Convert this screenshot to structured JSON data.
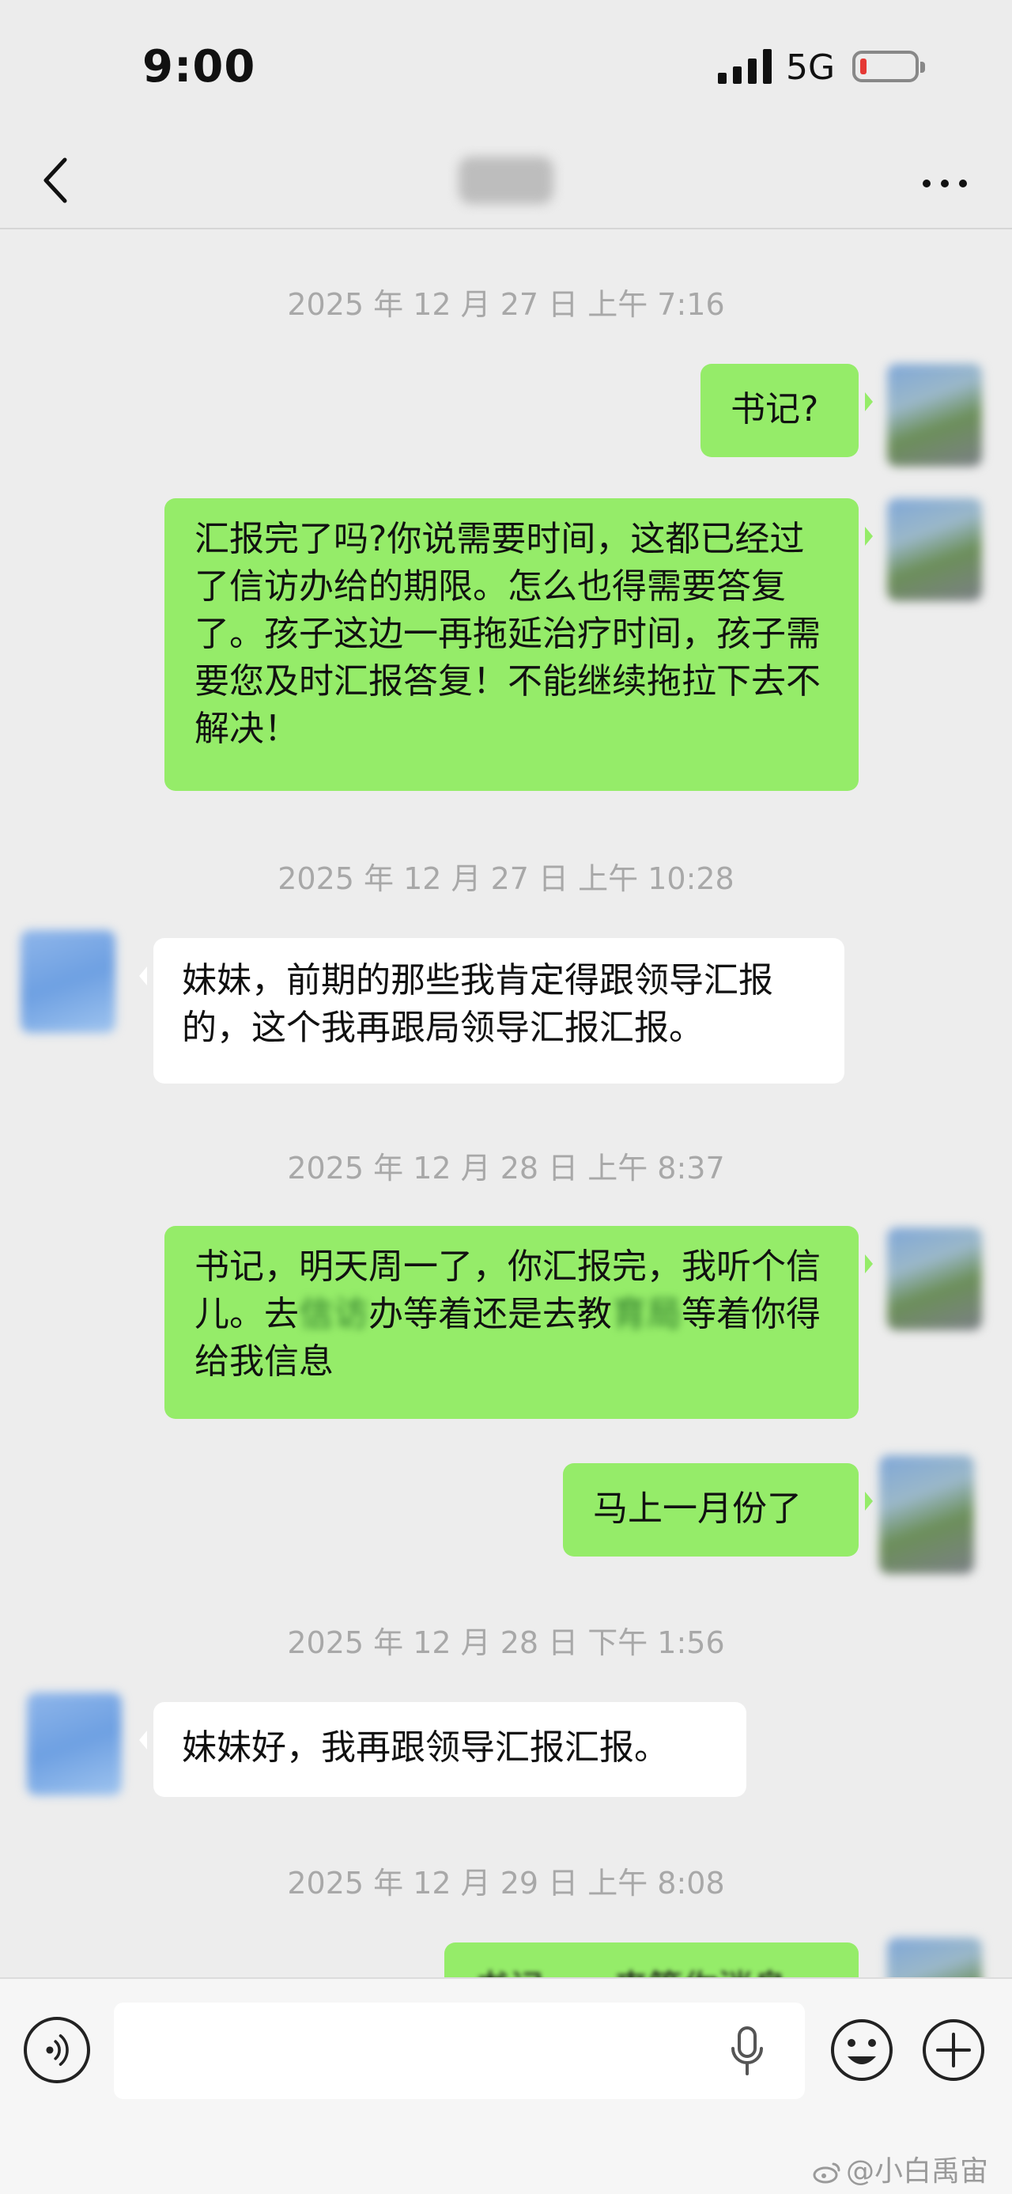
{
  "status_bar": {
    "time": "9:00",
    "network": "5G",
    "battery_level": 0.08,
    "battery_color": "#e53935"
  },
  "nav": {
    "back_icon": "chevron-left-icon",
    "more_icon": "more-dots-icon"
  },
  "messages": [
    {
      "type": "timestamp",
      "text": "2025 年 12 月 27 日 上午 7:16"
    },
    {
      "type": "out",
      "text": "书记?"
    },
    {
      "type": "out",
      "text": "汇报完了吗?你说需要时间，这都已经过了信访办给的期限。怎么也得需要答复了。孩子这边一再拖延治疗时间，孩子需要您及时汇报答复！不能继续拖拉下去不解决！"
    },
    {
      "type": "timestamp",
      "text": "2025 年 12 月 27 日 上午 10:28"
    },
    {
      "type": "in",
      "text": "妹妹，前期的那些我肯定得跟领导汇报的，这个我再跟局领导汇报汇报。"
    },
    {
      "type": "timestamp",
      "text": "2025 年 12 月 28 日 上午 8:37"
    },
    {
      "type": "out",
      "parts": [
        "书记，明天周一了，你汇报完，我听个信儿。去",
        "信访",
        "办等着还是去教",
        "育局",
        "等着你得给我信息"
      ]
    },
    {
      "type": "out",
      "text": "马上一月份了"
    },
    {
      "type": "timestamp",
      "text": "2025 年 12 月 28 日 下午 1:56"
    },
    {
      "type": "in",
      "text": "妹妹好，我再跟领导汇报汇报。"
    },
    {
      "type": "timestamp",
      "text": "2025 年 12 月 29 日 上午 8:08"
    },
    {
      "type": "out",
      "text": "书记……来等你消息"
    }
  ],
  "input_bar": {
    "voice_icon": "voice-mode-icon",
    "mic_icon": "microphone-icon",
    "emoji_icon": "emoji-icon",
    "plus_icon": "plus-circle-icon"
  },
  "watermark": {
    "icon": "weibo-icon",
    "text": "@小白禹宙"
  },
  "colors": {
    "outgoing_bubble": "#95ec69",
    "incoming_bubble": "#ffffff",
    "chat_background": "#ededed"
  }
}
